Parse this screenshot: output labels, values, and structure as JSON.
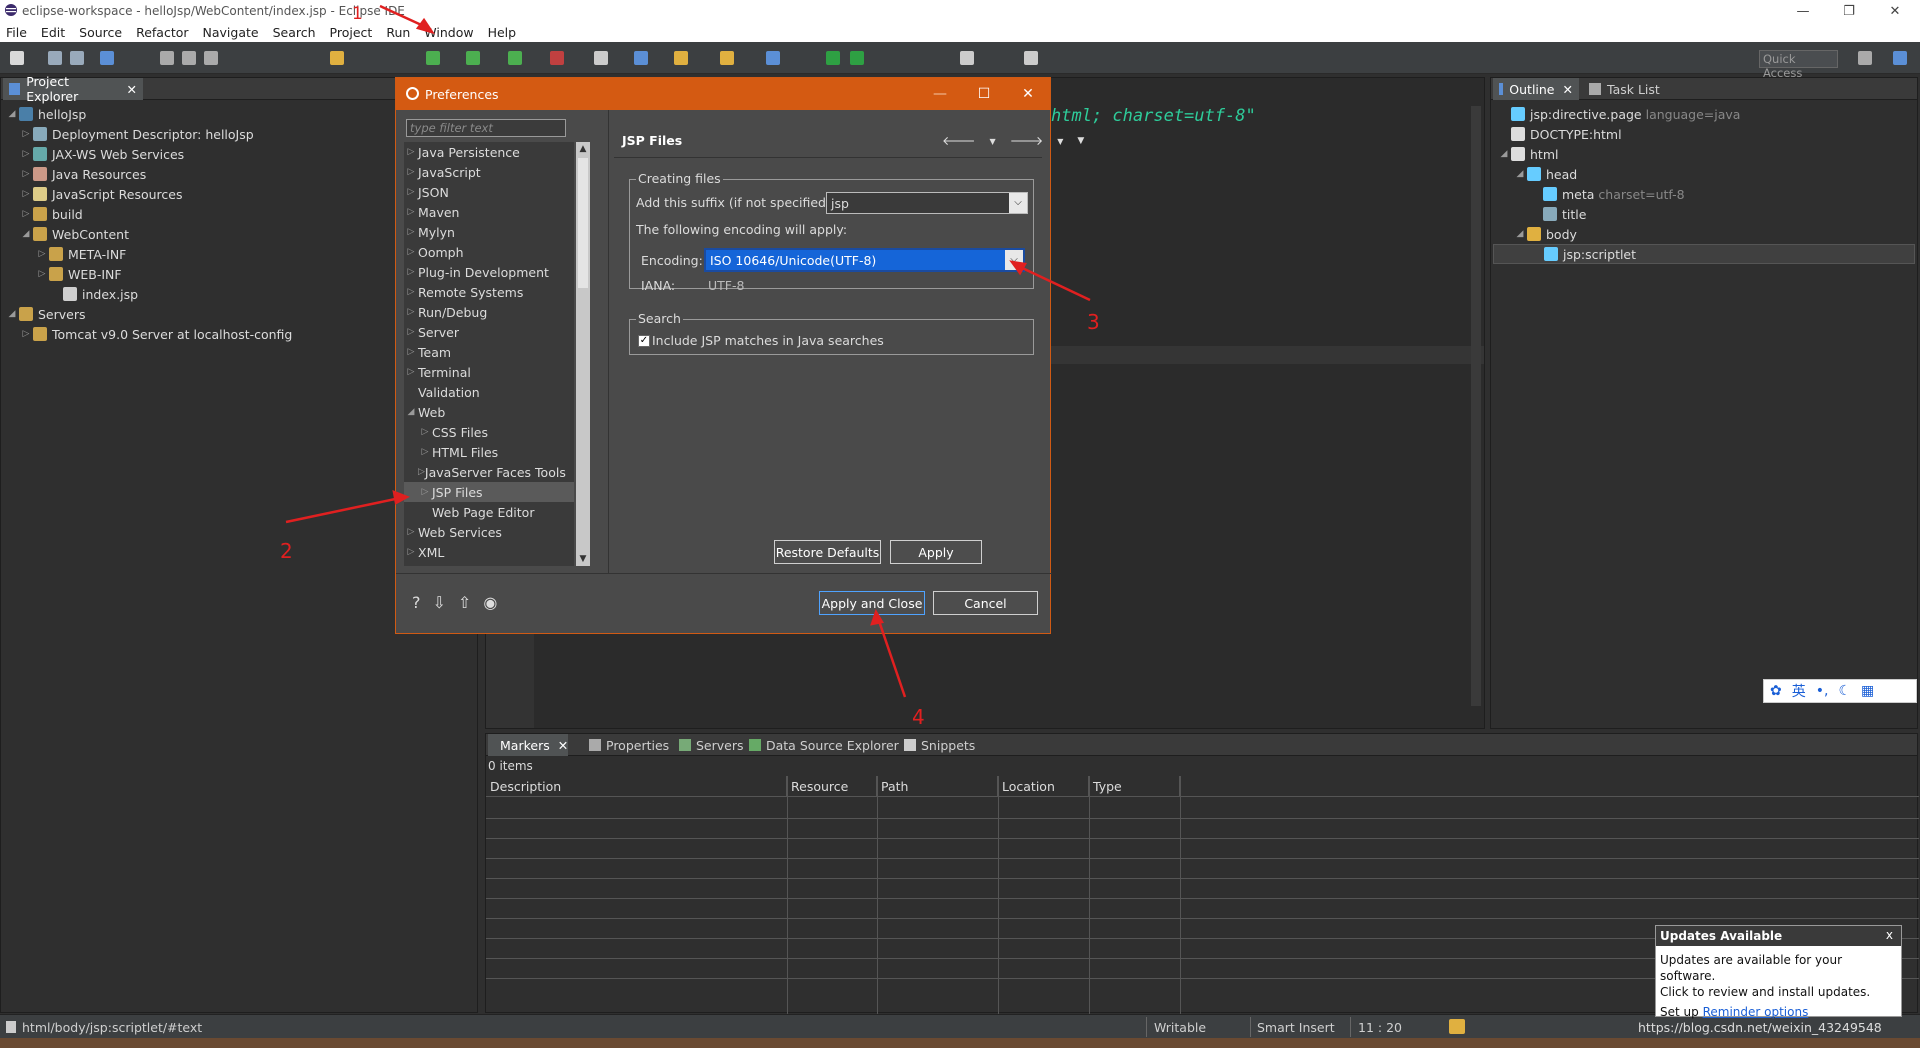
{
  "window": {
    "title": "eclipse-workspace - helloJsp/WebContent/index.jsp - Eclipse IDE",
    "controls": {
      "minimize": "—",
      "restore": "❐",
      "close": "✕"
    }
  },
  "menu": {
    "items": [
      {
        "label": "File"
      },
      {
        "label": "Edit"
      },
      {
        "label": "Source"
      },
      {
        "label": "Refactor"
      },
      {
        "label": "Navigate"
      },
      {
        "label": "Search"
      },
      {
        "label": "Project"
      },
      {
        "label": "Run"
      },
      {
        "label": "Window"
      },
      {
        "label": "Help"
      }
    ]
  },
  "toolbar": {
    "quick_access": "Quick Access"
  },
  "project_explorer": {
    "tab_label": "Project Explorer",
    "tree": [
      {
        "label": "helloJsp",
        "arrow": "◢",
        "icon": "project-icon"
      },
      {
        "label": "Deployment Descriptor: helloJsp",
        "arrow": "▷",
        "icon": "descriptor-icon"
      },
      {
        "label": "JAX-WS Web Services",
        "arrow": "▷",
        "icon": "webservice-icon"
      },
      {
        "label": "Java Resources",
        "arrow": "▷",
        "icon": "java-resources-icon"
      },
      {
        "label": "JavaScript Resources",
        "arrow": "▷",
        "icon": "javascript-resources-icon"
      },
      {
        "label": "build",
        "arrow": "▷",
        "icon": "folder-icon"
      },
      {
        "label": "WebContent",
        "arrow": "◢",
        "icon": "folder-icon"
      },
      {
        "label": "META-INF",
        "arrow": "▷",
        "icon": "folder-icon"
      },
      {
        "label": "WEB-INF",
        "arrow": "▷",
        "icon": "folder-icon"
      },
      {
        "label": "index.jsp",
        "arrow": "",
        "icon": "jsp-file-icon"
      },
      {
        "label": "Servers",
        "arrow": "◢",
        "icon": "folder-icon"
      },
      {
        "label": "Tomcat v9.0 Server at localhost-config",
        "arrow": "▷",
        "icon": "folder-icon"
      }
    ]
  },
  "editor": {
    "visible_code": "html; charset=utf-8\""
  },
  "outline": {
    "tab_label": "Outline",
    "tab2_label": "Task List",
    "tree": [
      {
        "label": "jsp:directive.page",
        "detail": "language=java"
      },
      {
        "label": "DOCTYPE:html",
        "detail": ""
      },
      {
        "label": "html",
        "detail": ""
      },
      {
        "label": "head",
        "detail": ""
      },
      {
        "label": "meta",
        "detail": "charset=utf-8"
      },
      {
        "label": "title",
        "detail": ""
      },
      {
        "label": "body",
        "detail": ""
      },
      {
        "label": "jsp:scriptlet",
        "detail": ""
      }
    ]
  },
  "ime_bar": {
    "lang": "英",
    "punct": "•,"
  },
  "preferences_dialog": {
    "title": "Preferences",
    "filter_placeholder": "type filter text",
    "tree": [
      {
        "label": "Java Persistence",
        "arrow": "▷"
      },
      {
        "label": "JavaScript",
        "arrow": "▷"
      },
      {
        "label": "JSON",
        "arrow": "▷"
      },
      {
        "label": "Maven",
        "arrow": "▷"
      },
      {
        "label": "Mylyn",
        "arrow": "▷"
      },
      {
        "label": "Oomph",
        "arrow": "▷"
      },
      {
        "label": "Plug-in Development",
        "arrow": "▷"
      },
      {
        "label": "Remote Systems",
        "arrow": "▷"
      },
      {
        "label": "Run/Debug",
        "arrow": "▷"
      },
      {
        "label": "Server",
        "arrow": "▷"
      },
      {
        "label": "Team",
        "arrow": "▷"
      },
      {
        "label": "Terminal",
        "arrow": "▷"
      },
      {
        "label": "Validation",
        "arrow": ""
      },
      {
        "label": "Web",
        "arrow": "◢"
      },
      {
        "label": "CSS Files",
        "arrow": "▷"
      },
      {
        "label": "HTML Files",
        "arrow": "▷"
      },
      {
        "label": "JavaServer Faces Tools",
        "arrow": "▷"
      },
      {
        "label": "JSP Files",
        "arrow": "▷"
      },
      {
        "label": "Web Page Editor",
        "arrow": ""
      },
      {
        "label": "Web Services",
        "arrow": "▷"
      },
      {
        "label": "XML",
        "arrow": "▷"
      }
    ],
    "page": {
      "title": "JSP Files",
      "creating_files_label": "Creating files",
      "suffix_label": "Add this suffix (if not specified):",
      "suffix_value": "jsp",
      "encoding_apply_text": "The following encoding will apply:",
      "encoding_label": "Encoding:",
      "encoding_value": "ISO 10646/Unicode(UTF-8)",
      "iana_label": "IANA:",
      "iana_value": "UTF-8",
      "search_label": "Search",
      "include_jsp_label": "Include JSP matches in Java searches",
      "include_jsp_checked": true,
      "restore_defaults": "Restore Defaults",
      "apply": "Apply"
    },
    "apply_and_close": "Apply and Close",
    "cancel": "Cancel"
  },
  "markers": {
    "tabs": [
      "Markers",
      "Properties",
      "Servers",
      "Data Source Explorer",
      "Snippets"
    ],
    "item_count": "0 items",
    "columns": [
      "Description",
      "Resource",
      "Path",
      "Location",
      "Type"
    ]
  },
  "statusbar": {
    "path": "html/body/jsp:scriptlet/#text",
    "writable": "Writable",
    "insert_mode": "Smart Insert",
    "position": "11 : 20"
  },
  "updates_popup": {
    "title": "Updates Available",
    "close": "x",
    "line1": "Updates are available for your software.",
    "line2": "Click to review and install updates.",
    "setup_text": "Set up",
    "reminder_link": "Reminder options"
  },
  "watermark": "https://blog.csdn.net/weixin_43249548",
  "annotations": [
    "1",
    "2",
    "3",
    "4"
  ],
  "colors": {
    "accent": "#d45a12",
    "selection": "#1565d8",
    "annotation": "#e02020"
  }
}
